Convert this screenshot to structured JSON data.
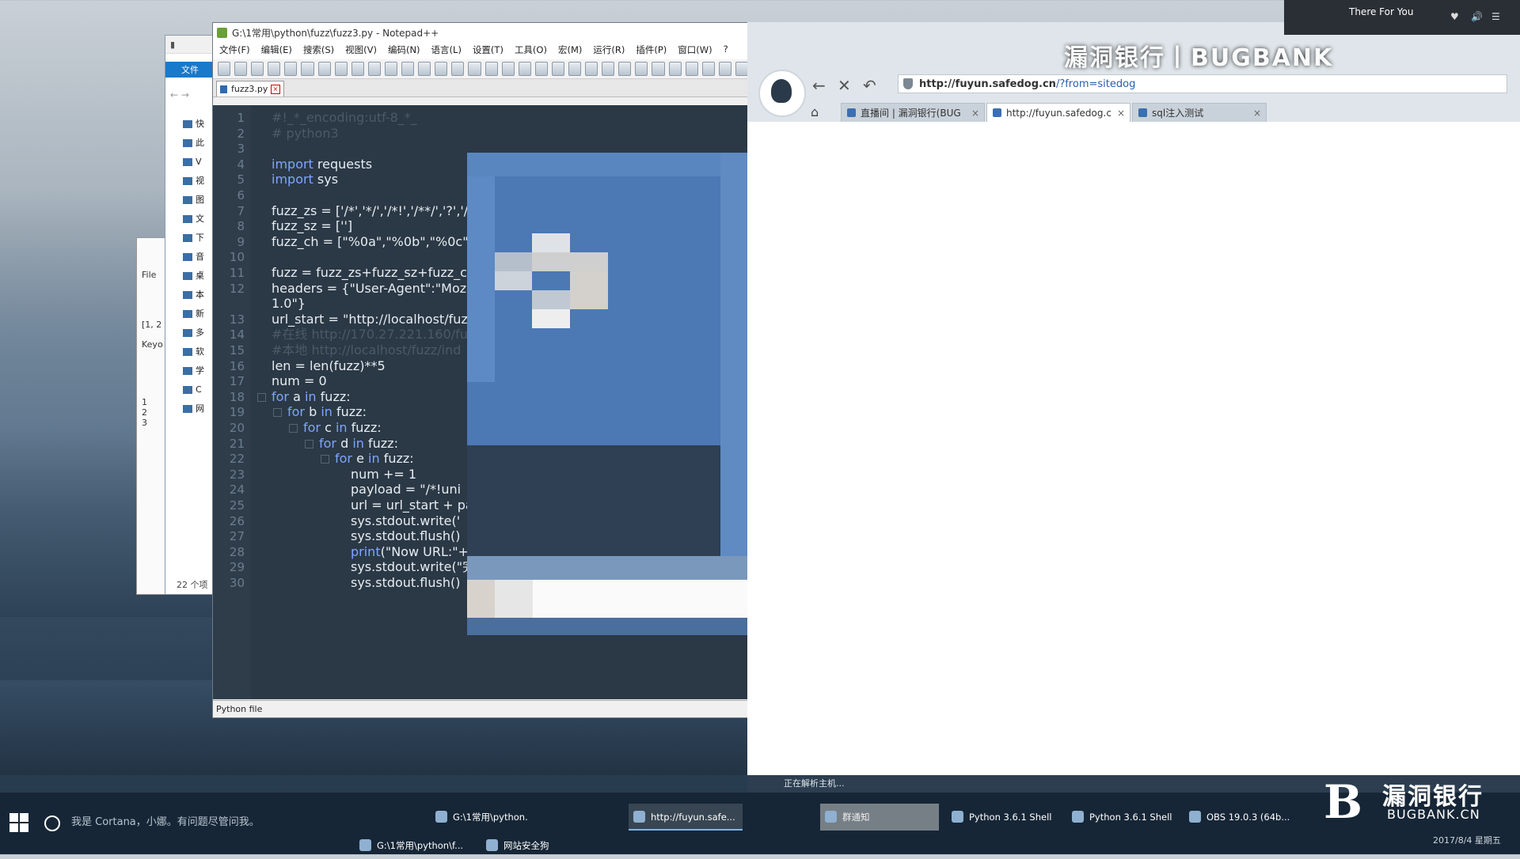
{
  "explorer": {
    "ribbon_label": "文件",
    "items": [
      "快",
      "此",
      "V",
      "视",
      "图",
      "文",
      "下",
      "音",
      "桌",
      "本",
      "新",
      "多",
      "软",
      "学",
      "C",
      "网"
    ],
    "count_label": "22 个项"
  },
  "side_window": {
    "file_label": "File",
    "selection": "[1, 2",
    "key_label": "Keyo",
    "lines": [
      "1",
      "2",
      "3"
    ]
  },
  "notepad": {
    "title": "G:\\1常用\\python\\fuzz\\fuzz3.py - Notepad++",
    "menu": [
      "文件(F)",
      "编辑(E)",
      "搜索(S)",
      "视图(V)",
      "编码(N)",
      "语言(L)",
      "设置(T)",
      "工具(O)",
      "宏(M)",
      "运行(R)",
      "插件(P)",
      "窗口(W)",
      "?"
    ],
    "tab_label": "fuzz3.py",
    "status": "Python file",
    "lines": [
      {
        "n": "1",
        "text": "#!_*_encoding:utf-8_*_",
        "cls": "cm",
        "indent": 0
      },
      {
        "n": "2",
        "text": "# python3",
        "cls": "cm",
        "indent": 0
      },
      {
        "n": "3",
        "text": "",
        "cls": "",
        "indent": 0
      },
      {
        "n": "4",
        "kw": "import",
        "text": " requests",
        "indent": 0
      },
      {
        "n": "5",
        "kw": "import",
        "text": " sys",
        "indent": 0
      },
      {
        "n": "6",
        "text": "",
        "indent": 0
      },
      {
        "n": "7",
        "text": "fuzz_zs = ['/*','*/','/*!','/**/','?','/",
        "indent": 0
      },
      {
        "n": "8",
        "text": "fuzz_sz = ['']",
        "indent": 0
      },
      {
        "n": "9",
        "text": "fuzz_ch = [\"%0a\",\"%0b\",\"%0c\",",
        "indent": 0
      },
      {
        "n": "10",
        "text": "",
        "indent": 0
      },
      {
        "n": "11",
        "text": "fuzz = fuzz_zs+fuzz_sz+fuzz_ch",
        "indent": 0
      },
      {
        "n": "12",
        "text": "headers = {\"User-Agent\":\"Moz",
        "indent": 0
      },
      {
        "n": "",
        "text": "1.0\"}",
        "indent": 0
      },
      {
        "n": "13",
        "text": "url_start = \"http://localhost/fuz",
        "indent": 0
      },
      {
        "n": "14",
        "text": "#在线 http://170.27.221.160/fu",
        "cls": "cm",
        "indent": 0
      },
      {
        "n": "15",
        "text": "#本地 http://localhost/fuzz/ind",
        "cls": "cm",
        "indent": 0
      },
      {
        "n": "16",
        "text": "len = len(fuzz)**5",
        "indent": 0
      },
      {
        "n": "17",
        "text": "num = 0",
        "indent": 0
      },
      {
        "n": "18",
        "kw": "for",
        "text": " a ",
        "kw2": "in",
        "text2": " fuzz:",
        "indent": 0
      },
      {
        "n": "19",
        "kw": "for",
        "text": " b ",
        "kw2": "in",
        "text2": " fuzz:",
        "indent": 1
      },
      {
        "n": "20",
        "kw": "for",
        "text": " c ",
        "kw2": "in",
        "text2": " fuzz:",
        "indent": 2
      },
      {
        "n": "21",
        "kw": "for",
        "text": " d ",
        "kw2": "in",
        "text2": " fuzz:",
        "indent": 3
      },
      {
        "n": "22",
        "kw": "for",
        "text": " e ",
        "kw2": "in",
        "text2": " fuzz:",
        "indent": 4
      },
      {
        "n": "23",
        "text": "num += 1",
        "indent": 5
      },
      {
        "n": "24",
        "text": "payload = \"/*!uni",
        "indent": 5
      },
      {
        "n": "25",
        "text": "url = url_start + pa",
        "indent": 5
      },
      {
        "n": "26",
        "text": "sys.stdout.write(' ",
        "indent": 5
      },
      {
        "n": "27",
        "text": "sys.stdout.flush()",
        "indent": 5
      },
      {
        "n": "28",
        "kw": "print",
        "text": "(\"Now URL:\"+url)",
        "indent": 5
      },
      {
        "n": "29",
        "text": "sys.stdout.write(\"完成进度 : %s/%s \\r\" % (num,len))",
        "indent": 5
      },
      {
        "n": "30",
        "text": "sys.stdout.flush()",
        "indent": 5
      }
    ]
  },
  "browser": {
    "url_host": "http://fuyun.safedog.cn",
    "url_path": "/?from=sitedog",
    "banner": "漏洞银行丨BUGBANK",
    "tabs": [
      {
        "label": "直播间 | 漏洞银行(BUG",
        "active": false
      },
      {
        "label": "http://fuyun.safedog.c",
        "active": true
      },
      {
        "label": "sql注入测试",
        "active": false
      }
    ],
    "status": "正在解析主机..."
  },
  "music": {
    "title": "There For You"
  },
  "taskbar": {
    "cortana": "我是 Cortana，小娜。有问题尽管问我。",
    "tasks": [
      {
        "label": "G:\\1常用\\python...",
        "state": ""
      },
      {
        "label": "http://fuyun.safe...",
        "state": "active"
      },
      {
        "label": "群通知",
        "state": "dim"
      },
      {
        "label": "Python 3.6.1 Shell",
        "state": ""
      },
      {
        "label": "Python 3.6.1 Shell",
        "state": ""
      },
      {
        "label": "OBS 19.0.3 (64b...",
        "state": ""
      },
      {
        "label": "G:\\1常用\\python\\f...",
        "state": ""
      },
      {
        "label": "网站安全狗",
        "state": ""
      }
    ],
    "date": "2017/8/4 星期五"
  },
  "logo": {
    "cn": "漏洞银行",
    "en": "BUGBANK.CN"
  }
}
